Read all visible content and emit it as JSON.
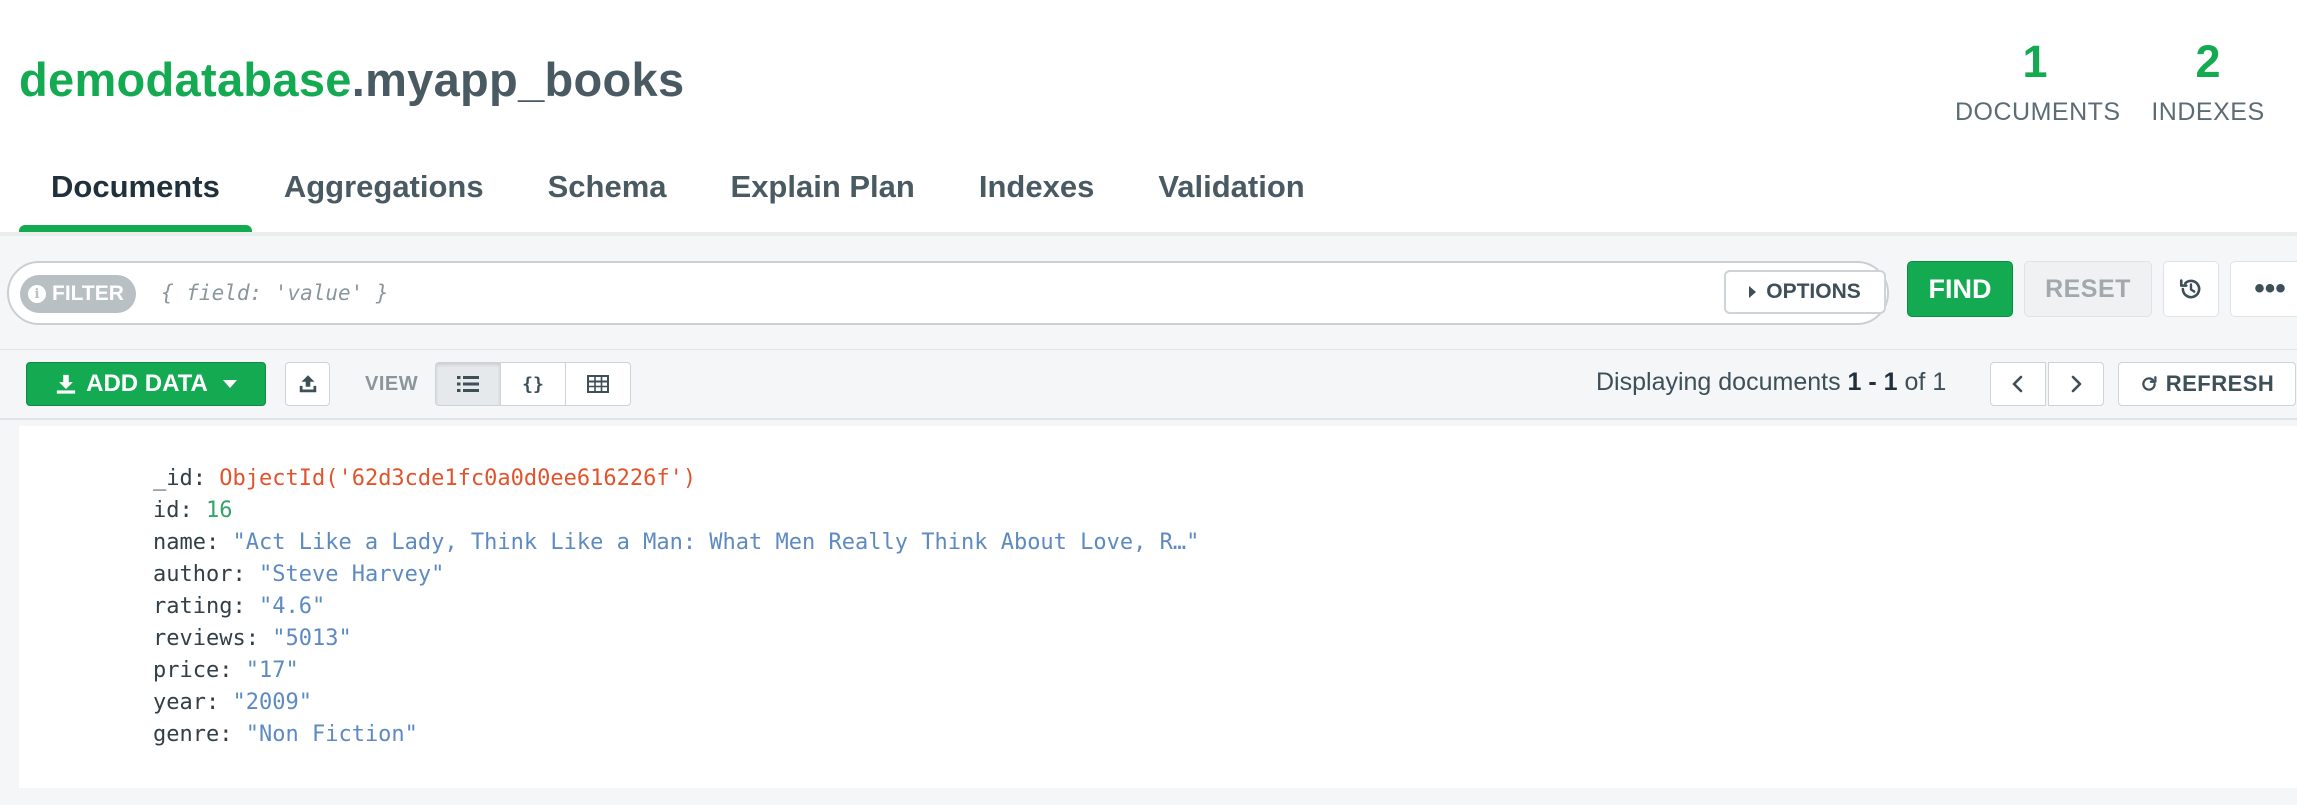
{
  "header": {
    "database": "demodatabase",
    "separator": ".",
    "collection": "myapp_books",
    "stats": {
      "documents": {
        "value": "1",
        "label": "DOCUMENTS"
      },
      "indexes": {
        "value": "2",
        "label": "INDEXES"
      }
    }
  },
  "tabs": [
    {
      "label": "Documents",
      "active": true
    },
    {
      "label": "Aggregations"
    },
    {
      "label": "Schema"
    },
    {
      "label": "Explain Plan"
    },
    {
      "label": "Indexes"
    },
    {
      "label": "Validation"
    }
  ],
  "query": {
    "filter_label": "FILTER",
    "info_icon_text": "i",
    "placeholder": "{ field: 'value' }",
    "options_label": "OPTIONS",
    "find_label": "FIND",
    "reset_label": "RESET",
    "more_label": "•••"
  },
  "toolbar": {
    "add_data_label": "ADD DATA",
    "view_label": "VIEW",
    "view_modes": [
      "list",
      "json",
      "table"
    ],
    "json_view_glyph": "{}",
    "pager": {
      "prefix": "Displaying documents",
      "range": "1 - 1",
      "of": "of",
      "total": "1"
    },
    "refresh_label": "REFRESH"
  },
  "document": {
    "fields": [
      {
        "key": "_id",
        "value": "ObjectId('62d3cde1fc0a0d0ee616226f')",
        "type": "oid"
      },
      {
        "key": "id",
        "value": "16",
        "type": "num"
      },
      {
        "key": "name",
        "value": "\"Act Like a Lady, Think Like a Man: What Men Really Think About Love, R…\"",
        "type": "str"
      },
      {
        "key": "author",
        "value": "\"Steve Harvey\"",
        "type": "str"
      },
      {
        "key": "rating",
        "value": "\"4.6\"",
        "type": "str"
      },
      {
        "key": "reviews",
        "value": "\"5013\"",
        "type": "str"
      },
      {
        "key": "price",
        "value": "\"17\"",
        "type": "str"
      },
      {
        "key": "year",
        "value": "\"2009\"",
        "type": "str"
      },
      {
        "key": "genre",
        "value": "\"Non Fiction\"",
        "type": "str"
      }
    ]
  },
  "colors": {
    "accent": "#13aa52",
    "text": "#3d4f58",
    "objectid": "#e0542c",
    "number": "#34a36b",
    "string": "#5d8ac1"
  },
  "icons": [
    "info-icon",
    "caret-right-icon",
    "history-icon",
    "more-icon",
    "download-icon",
    "caret-down-icon",
    "export-icon",
    "list-view-icon",
    "json-view-icon",
    "table-view-icon",
    "chevron-left-icon",
    "chevron-right-icon",
    "refresh-icon"
  ]
}
